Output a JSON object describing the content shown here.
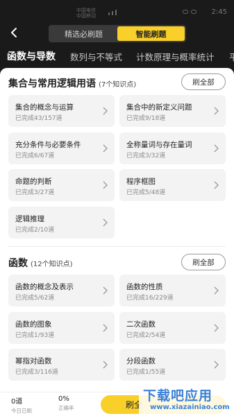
{
  "status": {
    "carrier_line1": "中国电信",
    "carrier_line2": "中国移动",
    "time": "2:45"
  },
  "header": {
    "tabs": [
      {
        "label": "精选必刷题",
        "active": false
      },
      {
        "label": "智能刷题",
        "active": true
      }
    ]
  },
  "categories": [
    "函数与导数",
    "数列与不等式",
    "计数原理与概率统计",
    "平"
  ],
  "sections": [
    {
      "title": "集合与常用逻辑用语",
      "count": "(7个知识点)",
      "button": "刷全部",
      "items": [
        {
          "title": "集合的概念与运算",
          "progress": "已完成43/157道"
        },
        {
          "title": "集合中的新定义问题",
          "progress": "已完成9/18道"
        },
        {
          "title": "充分条件与必要条件",
          "progress": "已完成6/67道"
        },
        {
          "title": "全称量词与存在量词",
          "progress": "已完成3/32道"
        },
        {
          "title": "命题的判断",
          "progress": "已完成3/27道"
        },
        {
          "title": "程序框图",
          "progress": "已完成5/48道"
        },
        {
          "title": "逻辑推理",
          "progress": "已完成2/10道"
        }
      ]
    },
    {
      "title": "函数",
      "count": "(12个知识点)",
      "button": "刷全部",
      "items": [
        {
          "title": "函数的概念及表示",
          "progress": "已完成5/62道"
        },
        {
          "title": "函数的性质",
          "progress": "已完成16/229道"
        },
        {
          "title": "函数的图象",
          "progress": "已完成1/93道"
        },
        {
          "title": "二次函数",
          "progress": "已完成2/54道"
        },
        {
          "title": "幂指对函数",
          "progress": "已完成3/116道"
        },
        {
          "title": "分段函数",
          "progress": "已完成1/55道"
        }
      ]
    }
  ],
  "bottom": {
    "today_value": "0道",
    "today_label": "今日已刷",
    "accuracy_value": "0%",
    "accuracy_label": "正确率",
    "cta": "刷全"
  },
  "watermark": {
    "big": "下载吧应用",
    "small": "www.xiazainiao.com"
  },
  "colors": {
    "accent": "#f9d02a",
    "background": "#1a1a1a",
    "card": "#f3f3f3"
  }
}
